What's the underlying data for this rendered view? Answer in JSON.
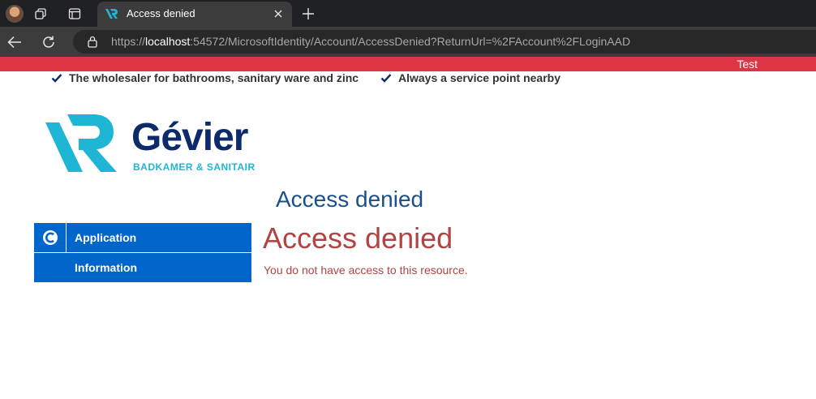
{
  "browser": {
    "tab": {
      "title": "Access denied"
    },
    "address_bar": {
      "scheme": "https://",
      "host": "localhost",
      "rest": ":54572/MicrosoftIdentity/Account/AccessDenied?ReturnUrl=%2FAccount%2FLoginAAD"
    },
    "icons": [
      "profile-avatar",
      "workspaces-icon",
      "tab-actions-icon",
      "site-favicon",
      "close-icon",
      "new-tab-icon",
      "back-icon",
      "refresh-icon",
      "lock-icon"
    ]
  },
  "environment_banner": {
    "label": "Test",
    "color": "#dc3545"
  },
  "usps": [
    {
      "text": "The wholesaler for bathrooms, sanitary ware and zinc"
    },
    {
      "text": "Always a service point nearby"
    }
  ],
  "logo": {
    "name": "Gévier",
    "tagline": "BADKAMER & SANITAIR",
    "colors": {
      "mark": "#1fb6d6",
      "name": "#0d2b6b"
    }
  },
  "page_heading": "Access denied",
  "sidebar": {
    "items": [
      {
        "label": "Application",
        "icon": "application-icon"
      },
      {
        "label": "Information",
        "icon": ""
      }
    ],
    "color": "#0066cc"
  },
  "error": {
    "title": "Access denied",
    "message": "You do not have access to this resource.",
    "color": "#b04444"
  }
}
